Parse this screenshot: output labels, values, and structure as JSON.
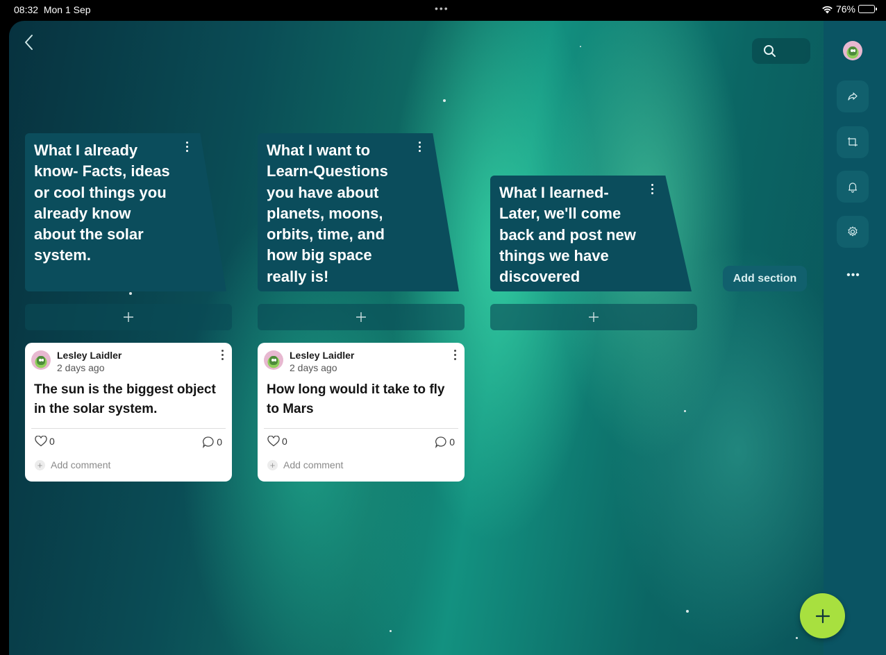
{
  "status_bar": {
    "time": "08:32",
    "date": "Mon 1 Sep",
    "center_dots": "•••",
    "battery": "76%"
  },
  "toolbar": {
    "back_icon": "chevron-left-icon",
    "search_icon": "search-icon"
  },
  "rail": {
    "items": [
      {
        "icon": "profile-avatar"
      },
      {
        "icon": "share-icon"
      },
      {
        "icon": "remake-icon"
      },
      {
        "icon": "bell-icon"
      },
      {
        "icon": "gear-icon"
      },
      {
        "icon": "more-icon",
        "label": "•••"
      }
    ]
  },
  "sections": [
    {
      "title": "What I already know- Facts, ideas or cool things you already know about the solar system."
    },
    {
      "title": "What I want to Learn-Questions you have about planets, moons, orbits, time, and how big space really is!"
    },
    {
      "title": "What I learned- Later, we'll come back and post new things we have discovered"
    }
  ],
  "add_post_label": "+",
  "posts": [
    {
      "author": "Lesley Laidler",
      "time": "2 days ago",
      "text": "The sun is the biggest object in the solar system.",
      "likes": "0",
      "comments": "0",
      "add_comment": "Add comment"
    },
    {
      "author": "Lesley Laidler",
      "time": "2 days ago",
      "text": "How long would it take to fly to Mars",
      "likes": "0",
      "comments": "0",
      "add_comment": "Add comment"
    }
  ],
  "add_section_label": "Add section",
  "fab_label": "+",
  "colors": {
    "header_bg": "#0b4d5c",
    "rail_bg": "#0a5463",
    "fab": "#a8e03f",
    "card_bg": "#ffffff"
  }
}
